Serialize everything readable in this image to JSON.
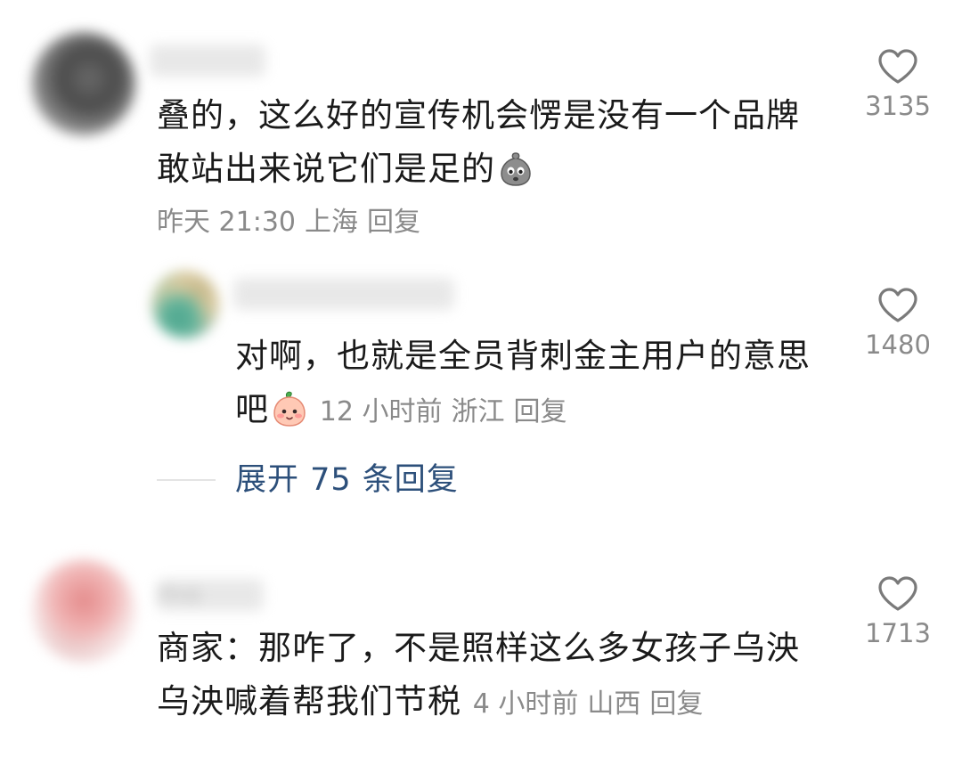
{
  "comments": [
    {
      "username": "blurred",
      "text_line1": "叠的，这么好的宣传机会愣是没有一个品牌",
      "text_line2": "敢站出来说它们是足的",
      "emoji": "worried-sack-emoji",
      "time": "昨天 21:30",
      "location": "上海",
      "reply_label": "回复",
      "likes": "3135",
      "replies": [
        {
          "username": "blurred",
          "text_line1": "对啊，也就是全员背刺金主用户的意思",
          "text_line2": "吧",
          "emoji": "peach-face-emoji",
          "time": "12 小时前",
          "location": "浙江",
          "reply_label": "回复",
          "likes": "1480"
        }
      ],
      "expand_label": "展开 75 条回复"
    },
    {
      "username": "mo",
      "text_line1": "商家：那咋了，不是照样这么多女孩子乌泱",
      "text_line2": "乌泱喊着帮我们节税",
      "time": "4 小时前",
      "location": "山西",
      "reply_label": "回复",
      "likes": "1713"
    }
  ],
  "colors": {
    "text": "#1a1a1a",
    "meta": "#8a8a8a",
    "link": "#2c4f7a",
    "heart_stroke": "#7a7a7a"
  }
}
